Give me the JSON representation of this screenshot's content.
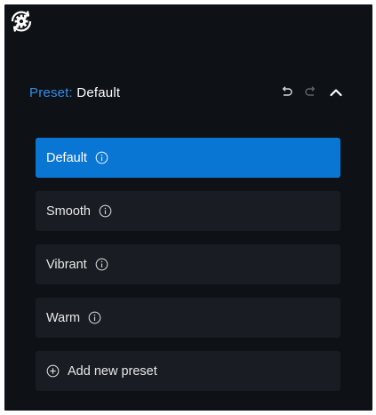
{
  "header": {
    "prefix": "Preset:",
    "value": "Default"
  },
  "presets": [
    {
      "label": "Default",
      "selected": true
    },
    {
      "label": "Smooth",
      "selected": false
    },
    {
      "label": "Vibrant",
      "selected": false
    },
    {
      "label": "Warm",
      "selected": false
    }
  ],
  "add_preset_label": "Add new preset",
  "icons": {
    "app": "gear-sync-icon",
    "undo": "undo-icon",
    "redo": "redo-icon",
    "collapse": "chevron-up-icon",
    "info": "info-icon",
    "add": "plus-circle-icon"
  },
  "colors": {
    "panel_bg": "#0e1116",
    "item_bg": "#191c22",
    "selected_bg": "#0a76d4",
    "accent": "#2f8dea"
  }
}
